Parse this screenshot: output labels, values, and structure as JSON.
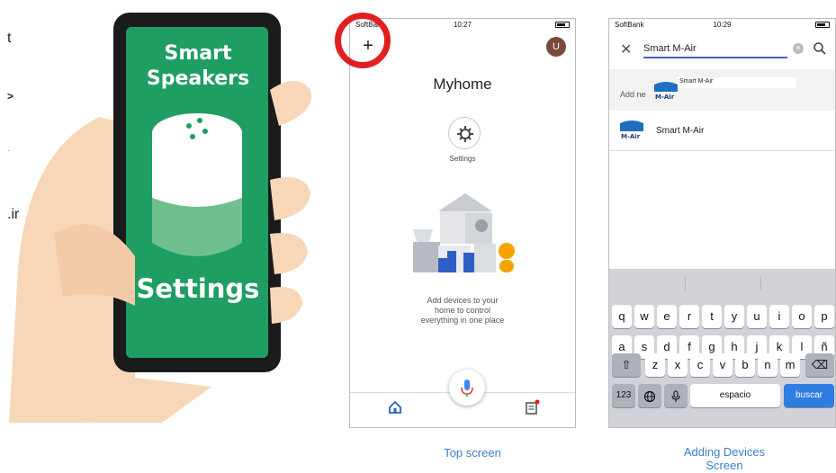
{
  "left_panel": {
    "clipped_text": [
      "t",
      ">",
      "·",
      ".ir"
    ],
    "phone_labels": {
      "line1": "Smart",
      "line2": "Speakers",
      "bottom": "Settings"
    }
  },
  "top_screen": {
    "status": {
      "carrier": "SoftBank",
      "time": "10:27"
    },
    "add_button": "+",
    "avatar_letter": "U",
    "home_title": "Myhome",
    "settings_label": "Settings",
    "empty_message": [
      "Add devices to your",
      "home to control",
      "everything in one place"
    ],
    "caption": "Top screen"
  },
  "add_screen": {
    "status": {
      "carrier": "SoftBank",
      "time": "10:29"
    },
    "search_value": "Smart M-Air",
    "add_new_prefix": "Add ne",
    "add_new_name": "Smart M-Air",
    "brand_logo_text": "M-Air",
    "result_name": "Smart M-Air",
    "keyboard": {
      "row1": [
        "q",
        "w",
        "e",
        "r",
        "t",
        "y",
        "u",
        "i",
        "o",
        "p"
      ],
      "row2": [
        "a",
        "s",
        "d",
        "f",
        "g",
        "h",
        "j",
        "k",
        "l",
        "ñ"
      ],
      "row3": [
        "z",
        "x",
        "c",
        "v",
        "b",
        "n",
        "m"
      ],
      "numbers_key": "123",
      "space_key": "espacio",
      "search_key": "buscar"
    },
    "caption": [
      "Adding Devices",
      "Screen"
    ]
  },
  "colors": {
    "phone_green": "#1e9e63",
    "accent_blue": "#3b7fc4",
    "highlight_red": "#e02020",
    "search_key_blue": "#2f7de1",
    "hand_skin": "#f7d7b8"
  }
}
